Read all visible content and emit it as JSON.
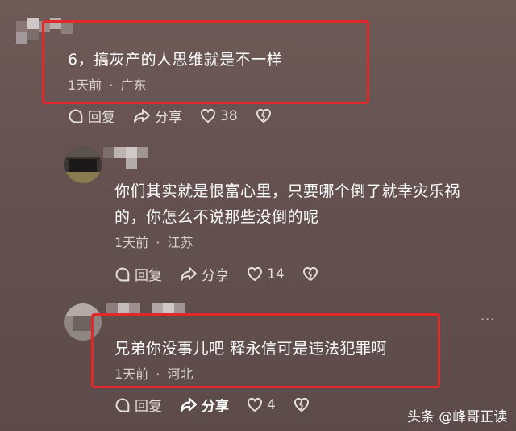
{
  "comments": [
    {
      "text": "6，搞灰产的人思维就是不一样",
      "time": "1天前",
      "location": "广东",
      "reply_label": "回复",
      "share_label": "分享",
      "likes": "38"
    },
    {
      "text_line1": "你们其实就是恨富心里，只要哪个倒了就幸灾乐祸",
      "text_line2": "的，你怎么不说那些没倒的呢",
      "time": "1天前",
      "location": "江苏",
      "reply_label": "回复",
      "share_label": "分享",
      "likes": "14"
    },
    {
      "text": "兄弟你没事儿吧 释永信可是违法犯罪啊",
      "time": "1天前",
      "location": "河北",
      "reply_label": "回复",
      "share_label": "分享",
      "likes": "4"
    }
  ],
  "separator": "·",
  "more_icon": "···",
  "watermark": "头条 @峰哥正读",
  "colors": {
    "highlight_border": "#e3282a",
    "background": "#64514f"
  }
}
